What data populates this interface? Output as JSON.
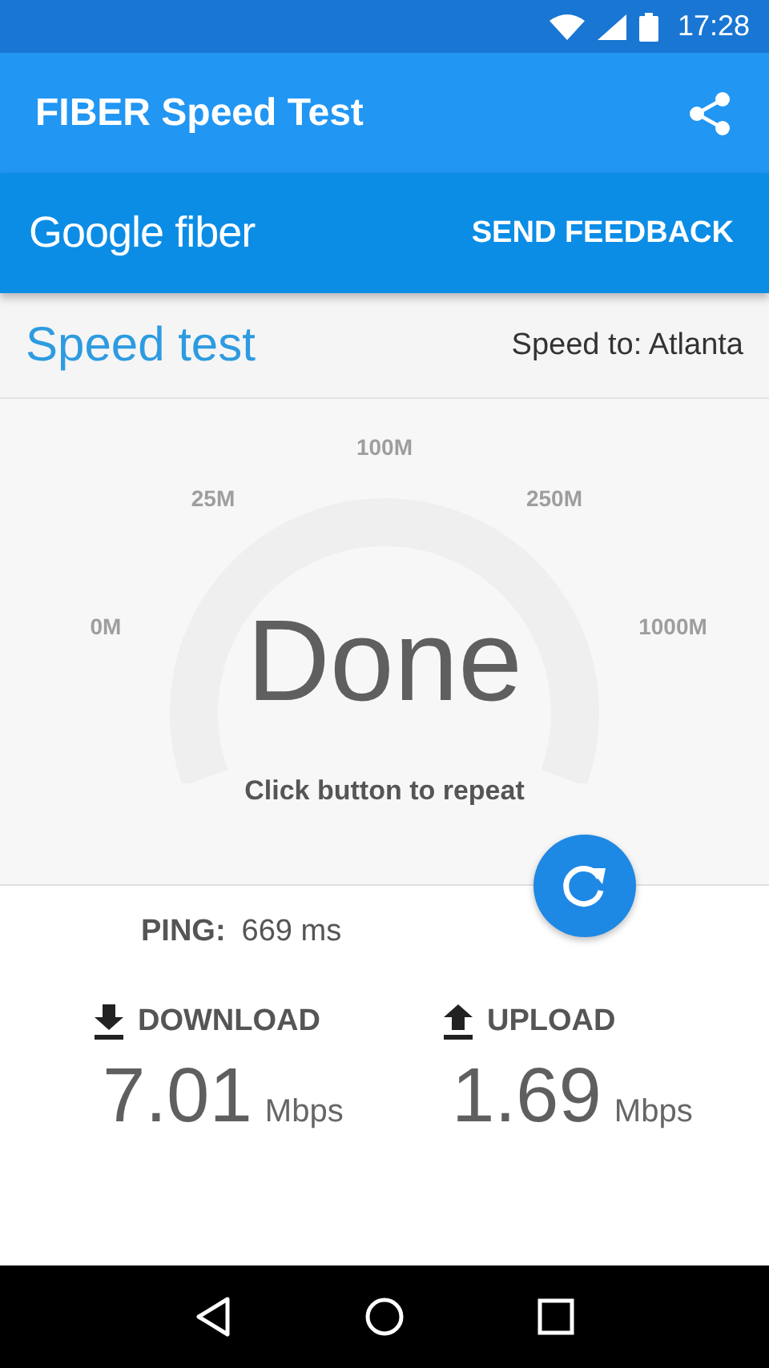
{
  "status_bar": {
    "time": "17:28"
  },
  "toolbar": {
    "title": "FIBER Speed Test"
  },
  "banner": {
    "logo": "Google fiber",
    "action": "SEND FEEDBACK"
  },
  "header": {
    "title": "Speed test",
    "server": "Speed to: Atlanta"
  },
  "gauge": {
    "ticks": [
      "0M",
      "25M",
      "100M",
      "250M",
      "1000M"
    ],
    "status": "Done",
    "hint": "Click button to repeat"
  },
  "ping": {
    "label": "PING:",
    "value": "669 ms"
  },
  "results": [
    {
      "kind": "download",
      "label": "DOWNLOAD",
      "value": "7.01",
      "unit": "Mbps"
    },
    {
      "kind": "upload",
      "label": "UPLOAD",
      "value": "1.69",
      "unit": "Mbps"
    }
  ]
}
